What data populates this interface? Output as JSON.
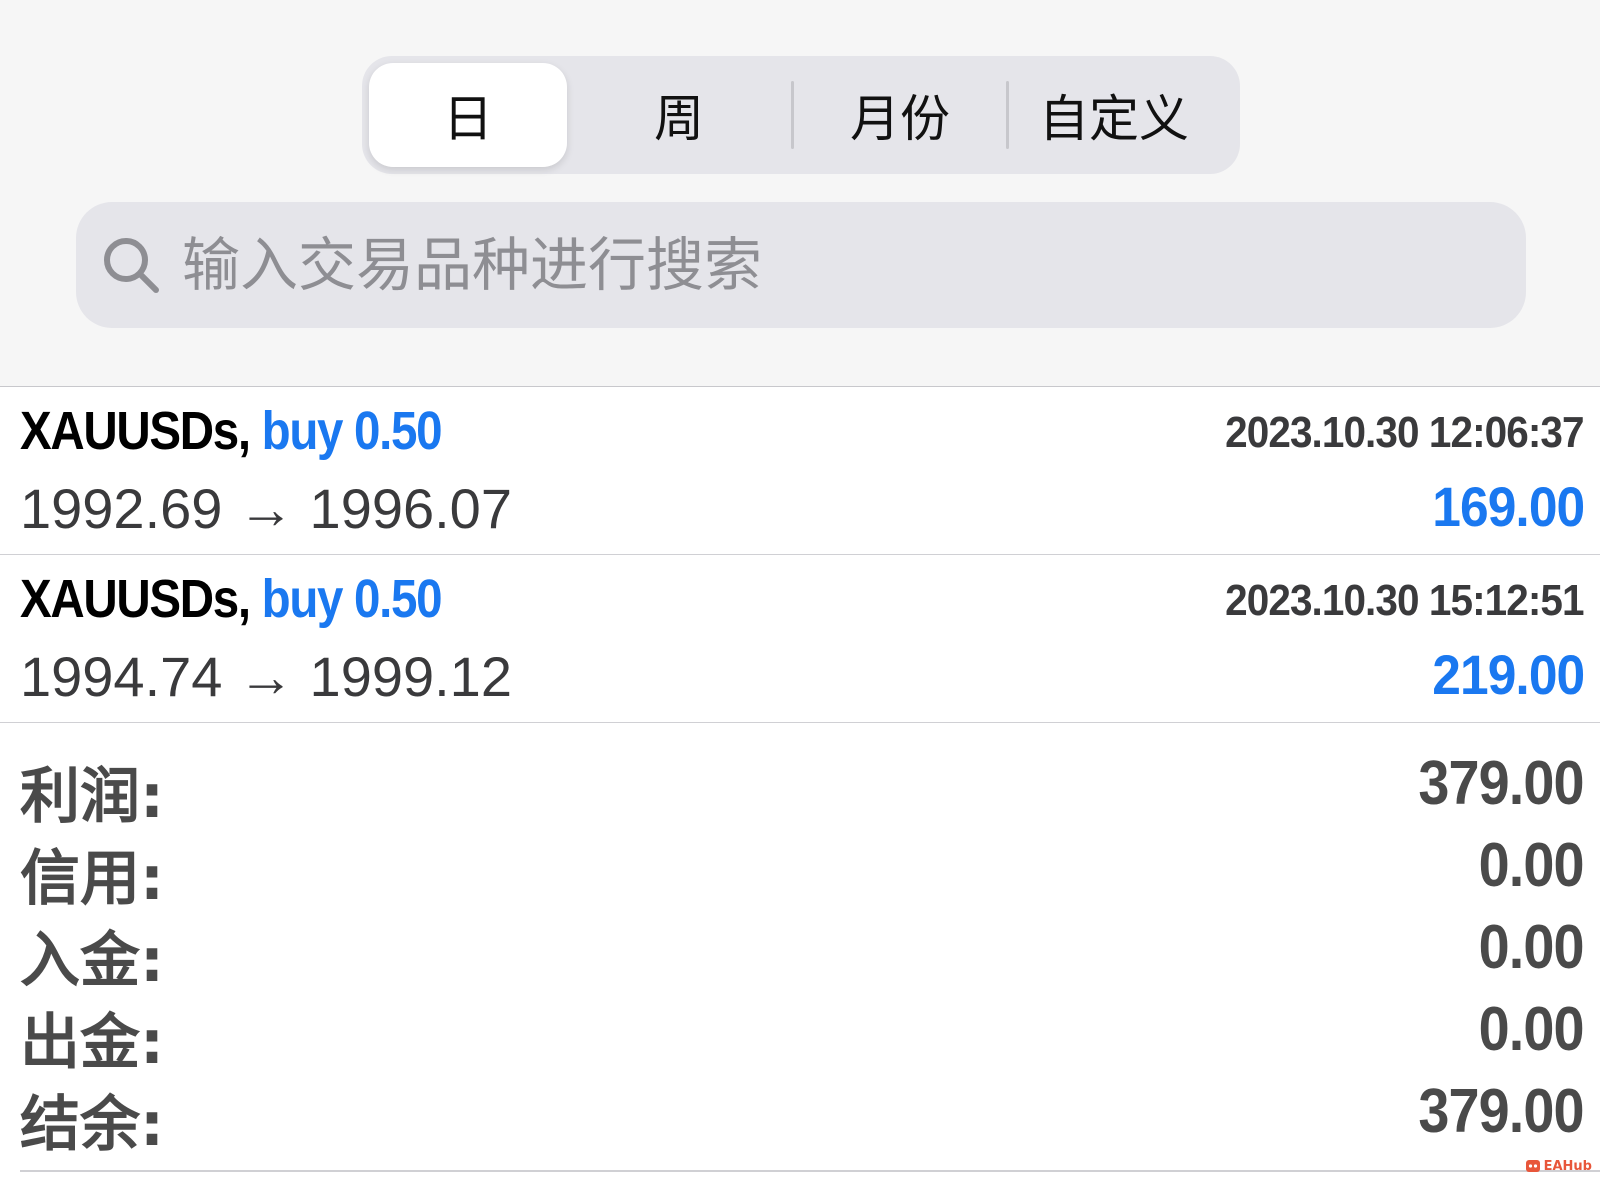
{
  "tabs": [
    {
      "label": "日",
      "active": true
    },
    {
      "label": "周",
      "active": false
    },
    {
      "label": "月份",
      "active": false
    },
    {
      "label": "自定义",
      "active": false
    }
  ],
  "search": {
    "placeholder": "输入交易品种进行搜索",
    "icon": "search-icon"
  },
  "trades": [
    {
      "symbol": "XAUUSDs,",
      "side": "buy",
      "volume": "0.50",
      "time": "2023.10.30 12:06:37",
      "prices": "1992.69 → 1996.07",
      "profit": "169.00"
    },
    {
      "symbol": "XAUUSDs,",
      "side": "buy",
      "volume": "0.50",
      "time": "2023.10.30 15:12:51",
      "prices": "1994.74 → 1999.12",
      "profit": "219.00"
    }
  ],
  "summary": [
    {
      "label": "利润:",
      "value": "379.00"
    },
    {
      "label": "信用:",
      "value": "0.00"
    },
    {
      "label": "入金:",
      "value": "0.00"
    },
    {
      "label": "出金:",
      "value": "0.00"
    },
    {
      "label": "结余:",
      "value": "379.00"
    }
  ],
  "watermark": {
    "text": "EAHub"
  },
  "colors": {
    "accent": "#1a78f0",
    "background": "#f6f6f6",
    "segment_bg": "#e5e5ea"
  }
}
